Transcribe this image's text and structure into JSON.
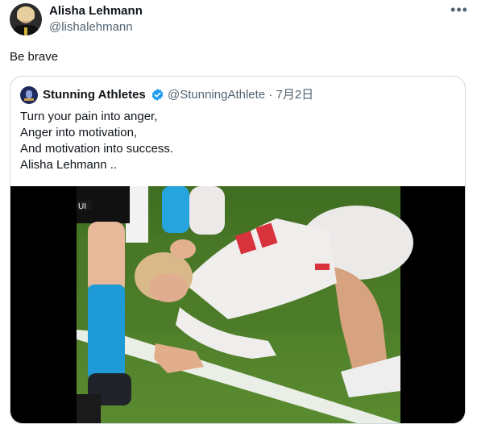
{
  "author": {
    "name": "Alisha Lehmann",
    "handle": "@lishalehmann"
  },
  "tweet": {
    "text": "Be brave"
  },
  "quoted": {
    "name": "Stunning Athletes",
    "handle_line": "@StunningAthlete · 7月2日",
    "lines": [
      "Turn your pain into anger,",
      "Anger into motivation,",
      "And motivation into success.",
      "Alisha Lehmann .."
    ],
    "media_overlay_text": "UI"
  },
  "icons": {
    "more": "more-horizontal-icon",
    "verified": "verified-badge-icon"
  },
  "colors": {
    "verified": "#1d9bf0",
    "secondary_text": "#536471",
    "pitch": "#4f7d2a",
    "kit_red": "#d8323c",
    "kit_white": "#f1eeee",
    "sock_blue": "#1e9bd6"
  }
}
